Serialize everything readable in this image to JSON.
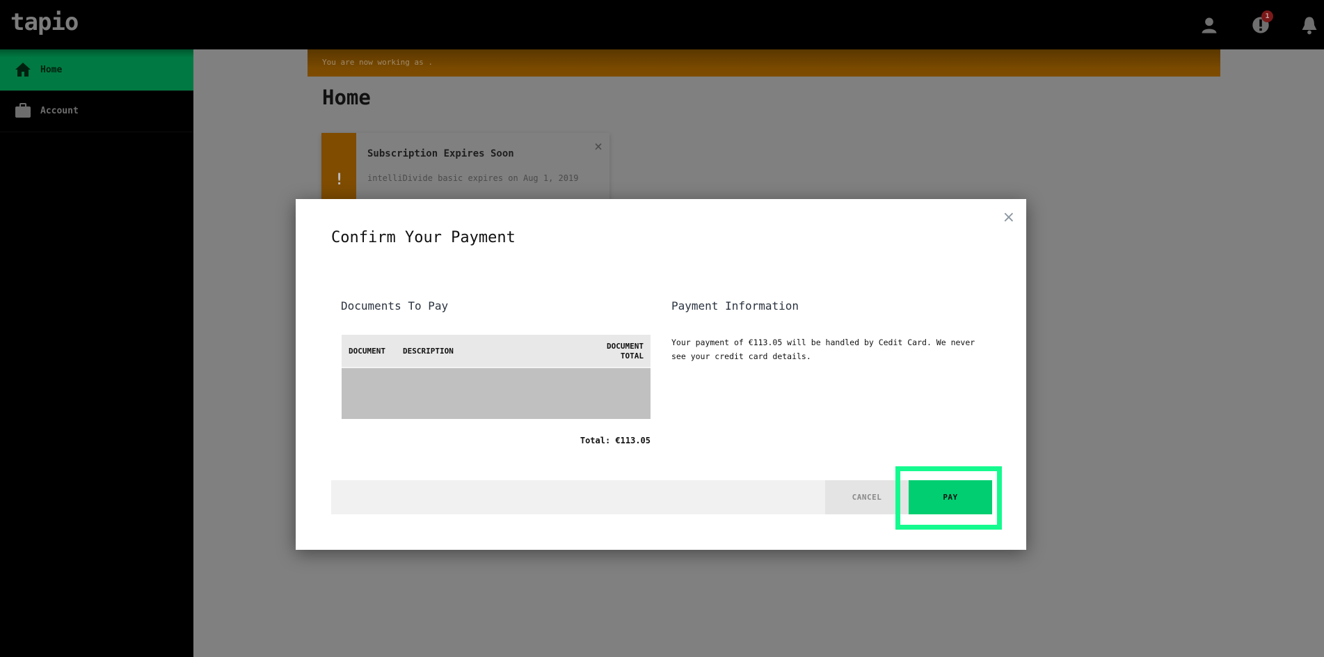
{
  "app": {
    "logo": "tapio",
    "notification_badge_count": "1"
  },
  "sidebar": {
    "items": [
      {
        "label": "Home",
        "icon": "home-icon",
        "active": true
      },
      {
        "label": "Account",
        "icon": "briefcase-icon",
        "active": false
      }
    ]
  },
  "main": {
    "banner_text": "You are now working as .",
    "page_title": "Home",
    "notice": {
      "title": "Subscription Expires Soon",
      "text": "intelliDivide basic expires on Aug 1, 2019",
      "icon": "!",
      "close": "×"
    }
  },
  "modal": {
    "title": "Confirm Your Payment",
    "close": "×",
    "documents": {
      "title": "Documents To Pay",
      "columns": [
        "DOCUMENT",
        "DESCRIPTION",
        "DOCUMENT TOTAL"
      ],
      "rows": [],
      "total": "Total: €113.05"
    },
    "payment_info": {
      "title": "Payment Information",
      "text": "Your payment of €113.05 will be handled by Cedit Card. We never see your credit card details."
    },
    "buttons": {
      "cancel": "CANCEL",
      "pay": "PAY"
    }
  },
  "colors": {
    "accent_green": "#00ce71",
    "highlight": "#14fa8f",
    "warning": "#f59b00"
  }
}
